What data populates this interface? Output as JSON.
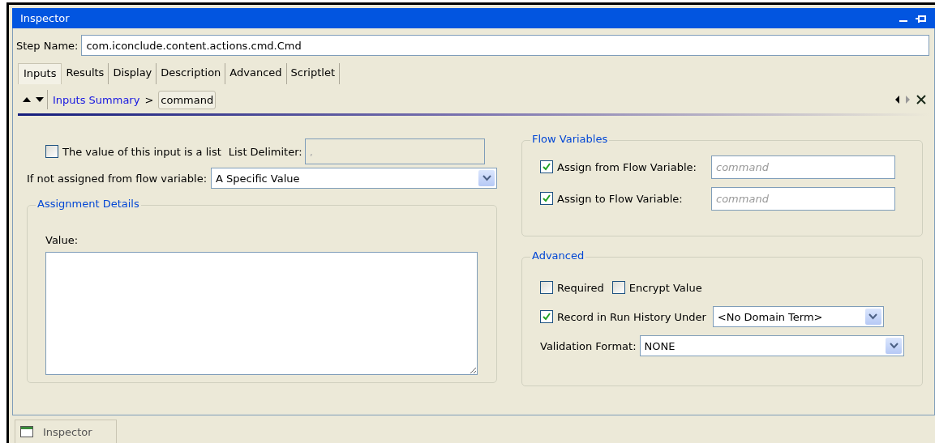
{
  "window": {
    "title": "Inspector"
  },
  "step_name": {
    "label": "Step Name:",
    "value": "com.iconclude.content.actions.cmd.Cmd"
  },
  "tabs": [
    {
      "label": "Inputs",
      "selected": true
    },
    {
      "label": "Results",
      "selected": false
    },
    {
      "label": "Display",
      "selected": false
    },
    {
      "label": "Description",
      "selected": false
    },
    {
      "label": "Advanced",
      "selected": false
    },
    {
      "label": "Scriptlet",
      "selected": false
    }
  ],
  "breadcrumb": {
    "link": "Inputs Summary",
    "separator": ">",
    "current": "command"
  },
  "list_option": {
    "label": "The value of this input is a list",
    "checked": false,
    "delimiter_label": "List Delimiter:",
    "delimiter_value": ",",
    "delimiter_disabled": true
  },
  "default_source": {
    "label": "If not assigned from flow variable:",
    "value": "A Specific Value"
  },
  "assignment_details": {
    "title": "Assignment Details",
    "value_label": "Value:"
  },
  "flow_variables": {
    "title": "Flow Variables",
    "rows": [
      {
        "label": "Assign from Flow Variable:",
        "checked": true,
        "placeholder": "command"
      },
      {
        "label": "Assign to Flow Variable:",
        "checked": true,
        "placeholder": "command"
      }
    ]
  },
  "advanced": {
    "title": "Advanced",
    "options": [
      {
        "label": "Required",
        "checked": false
      },
      {
        "label": "Encrypt Value",
        "checked": false
      }
    ],
    "record": {
      "label": "Record in Run History Under",
      "checked": true,
      "value": "<No Domain Term>"
    },
    "validation": {
      "label": "Validation Format:",
      "value": "NONE"
    }
  },
  "bottom_tabs": [
    {
      "label": "Inspector"
    }
  ]
}
